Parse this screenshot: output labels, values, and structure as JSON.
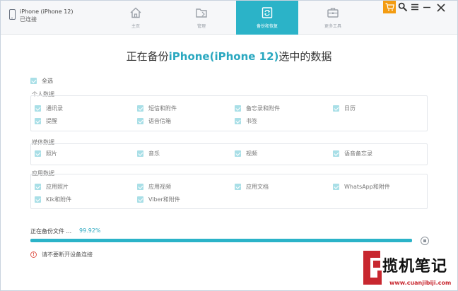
{
  "device": {
    "name": "iPhone (iPhone 12)",
    "status": "已连接"
  },
  "tabs": [
    {
      "label": "主页",
      "icon": "home-icon"
    },
    {
      "label": "管理",
      "icon": "folder-icon"
    },
    {
      "label": "备份和恢复",
      "icon": "backup-restore-icon",
      "active": true
    },
    {
      "label": "更多工具",
      "icon": "toolbox-icon"
    }
  ],
  "colors": {
    "accent": "#2bb3c8",
    "cart": "#f39c12",
    "warning": "#e05a4f",
    "checkbox": "#a9dfe7"
  },
  "title": {
    "prefix": "正在备份",
    "device": "iPhone(iPhone 12)",
    "suffix": "选中的数据"
  },
  "select_all": "全选",
  "groups": {
    "personal": {
      "title": "个人数据",
      "items": [
        "通讯录",
        "短信和附件",
        "备忘录和附件",
        "日历",
        "提醒",
        "语音信箱",
        "书签"
      ]
    },
    "media": {
      "title": "媒体数据",
      "items": [
        "照片",
        "音乐",
        "视频",
        "语音备忘录"
      ]
    },
    "apps": {
      "title": "应用数据",
      "items": [
        "应用照片",
        "应用视频",
        "应用文档",
        "WhatsApp和附件",
        "Kik和附件",
        "Viber和附件"
      ]
    }
  },
  "progress": {
    "label": "正在备份文件 ...",
    "percent_text": "99.92%",
    "value": 0.9992
  },
  "warning": "请不要断开设备连接",
  "watermark": {
    "text": "揽机笔记",
    "url": "www.cuanjibiji.com"
  }
}
